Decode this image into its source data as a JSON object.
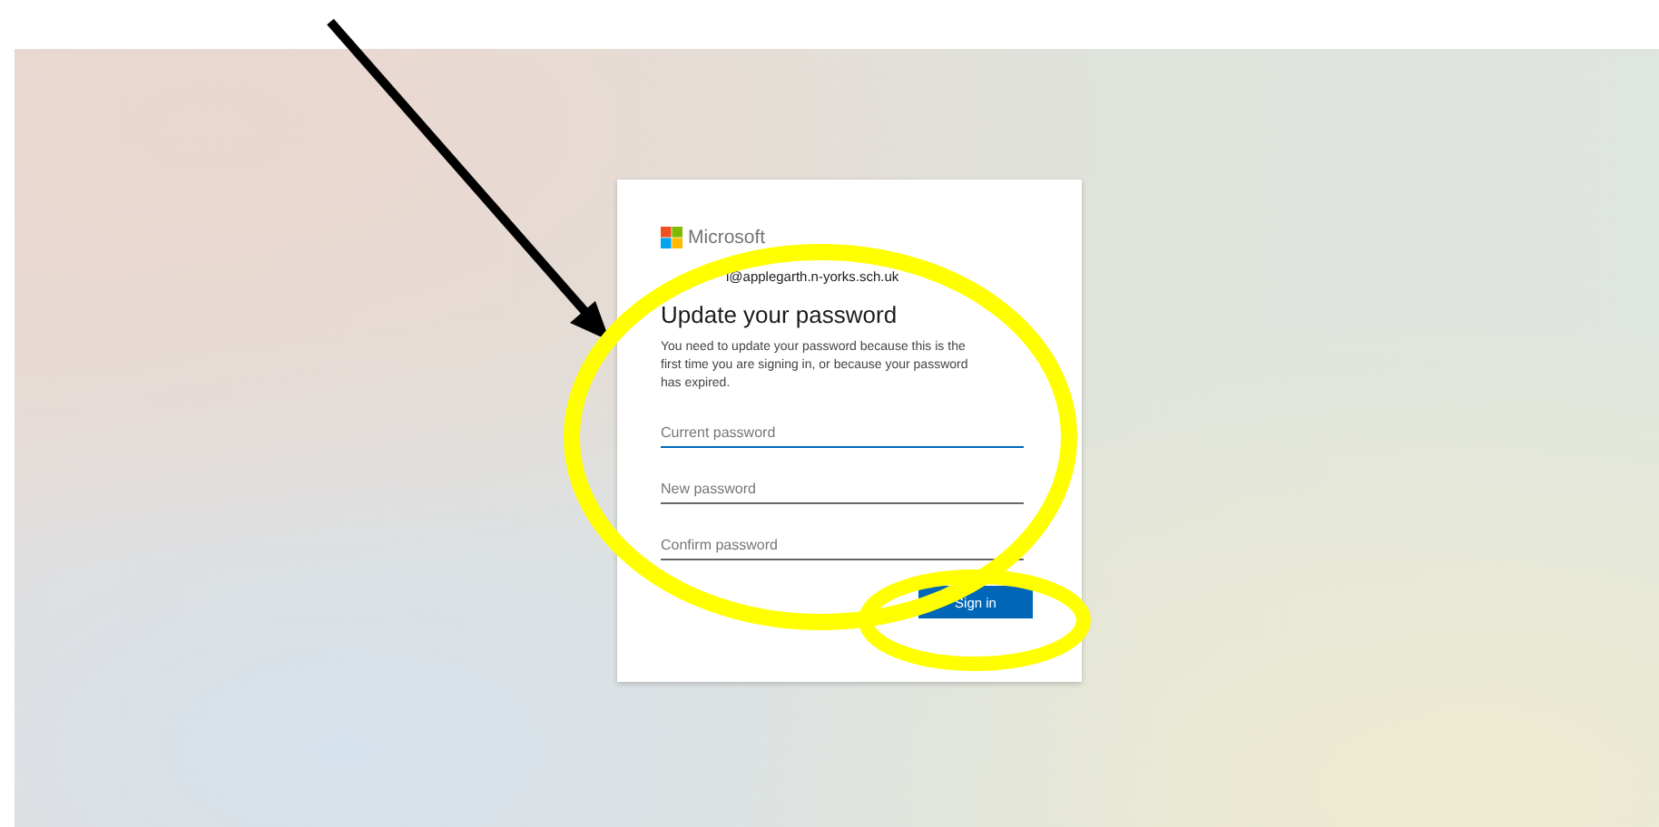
{
  "card": {
    "brand": "Microsoft",
    "account": "l@applegarth.n-yorks.sch.uk",
    "title": "Update your password",
    "message": "You need to update your password because this is the first time you are signing in, or because your password has expired.",
    "fields": [
      {
        "placeholder": "Current password",
        "focused": true
      },
      {
        "placeholder": "New password",
        "focused": false
      },
      {
        "placeholder": "Confirm password",
        "focused": false
      }
    ],
    "button": "Sign in"
  }
}
